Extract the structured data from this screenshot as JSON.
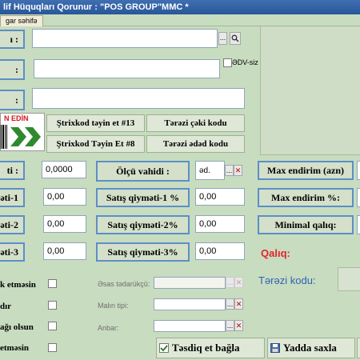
{
  "title": "lif  Hüquqları Qorunur : \"POS GROUP\"MMC *",
  "tab": "gar səhifə",
  "barcode_banner": "N EDİN",
  "checkbox_edv": "ƏDV-siz",
  "buttons": {
    "strix1": "Ştrixkod təyin et #13",
    "terazi_ceki": "Tərəzi çəki kodu",
    "strix2": "Ştrixkod Təyin Et #8",
    "terazi_eded": "Tərəzi ədəd kodu",
    "tesdiq": "Təsdiq et bağla",
    "yadda": "Yadda saxla"
  },
  "labels": {
    "l1": "ı :",
    "l2": ":",
    "l3": ":",
    "l4": "ti :",
    "l5": "əti-1",
    "l6": "əti-2",
    "l7": "əti-3",
    "olcu": "Ölçü vahidi :",
    "satis1": "Satış qiyməti-1 %",
    "satis2": "Satış qiyməti-2%",
    "satis3": "Satış qiyməti-3%",
    "max_azn": "Max endirim (azn)",
    "max_pct": "Max endirim %:",
    "minimal": "Minimal qalıq:"
  },
  "values": {
    "v_cost": "0,0000",
    "v_p1": "0,00",
    "v_p2": "0,00",
    "v_p3": "0,00",
    "unit": "əd.",
    "pct1": "0,00",
    "pct2": "0,00",
    "pct3": "0,00"
  },
  "info": {
    "qaliq": "Qalıq:",
    "terazi_kodu": "Tərəzi kodu:"
  },
  "side_options": [
    "k etməsin",
    "dır",
    "ağı olsun",
    "etməsin"
  ],
  "ghost_fields": {
    "esas": "Əsas tədarükçü:",
    "malin": "Malın tipi:",
    "anbar": "Anbar:"
  },
  "small_symbols": {
    "dots": "...",
    "search": "🔍",
    "close": "✕"
  },
  "colors": {
    "background": "#c8dcc0",
    "accent_blue": "#5b8fc7",
    "qaliq_red": "#e0262b",
    "terazi_blue": "#2f62b3"
  }
}
